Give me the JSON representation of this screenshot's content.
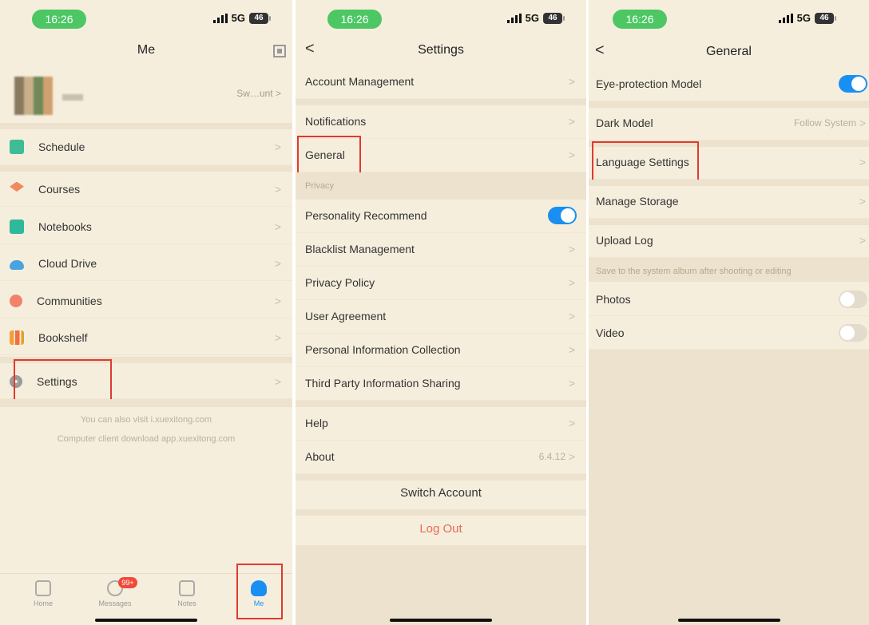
{
  "status": {
    "time": "16:26",
    "network": "5G",
    "battery": "46"
  },
  "me_screen": {
    "title": "Me",
    "profile_account": "Sw…unt",
    "menu": [
      "Schedule",
      "Courses",
      "Notebooks",
      "Cloud Drive",
      "Communities",
      "Bookshelf",
      "Settings"
    ],
    "footer_1": "You can also visit i.xuexitong.com",
    "footer_2": "Computer client download app.xuexitong.com",
    "tabs": {
      "home": "Home",
      "messages": "Messages",
      "notes": "Notes",
      "me": "Me"
    },
    "messages_badge": "99+"
  },
  "settings_screen": {
    "title": "Settings",
    "account_management": "Account Management",
    "notifications": "Notifications",
    "general": "General",
    "privacy_header": "Privacy",
    "personality_recommend": "Personality Recommend",
    "blacklist": "Blacklist Management",
    "privacy_policy": "Privacy Policy",
    "user_agreement": "User Agreement",
    "personal_info": "Personal Information Collection",
    "third_party": "Third Party Information Sharing",
    "help": "Help",
    "about": "About",
    "version": "6.4.12",
    "switch_account": "Switch Account",
    "log_out": "Log Out"
  },
  "general_screen": {
    "title": "General",
    "eye_protection": "Eye-protection Model",
    "dark_model": "Dark Model",
    "dark_value": "Follow System",
    "language": "Language Settings",
    "storage": "Manage Storage",
    "upload_log": "Upload Log",
    "album_note": "Save to the system album after shooting or editing",
    "photos": "Photos",
    "video": "Video"
  },
  "colors": {
    "background": "#f6eedd",
    "accent": "#1a8ff2",
    "highlight": "#e03a2f",
    "logout": "#e86a54",
    "status_pill": "#4cc764"
  }
}
